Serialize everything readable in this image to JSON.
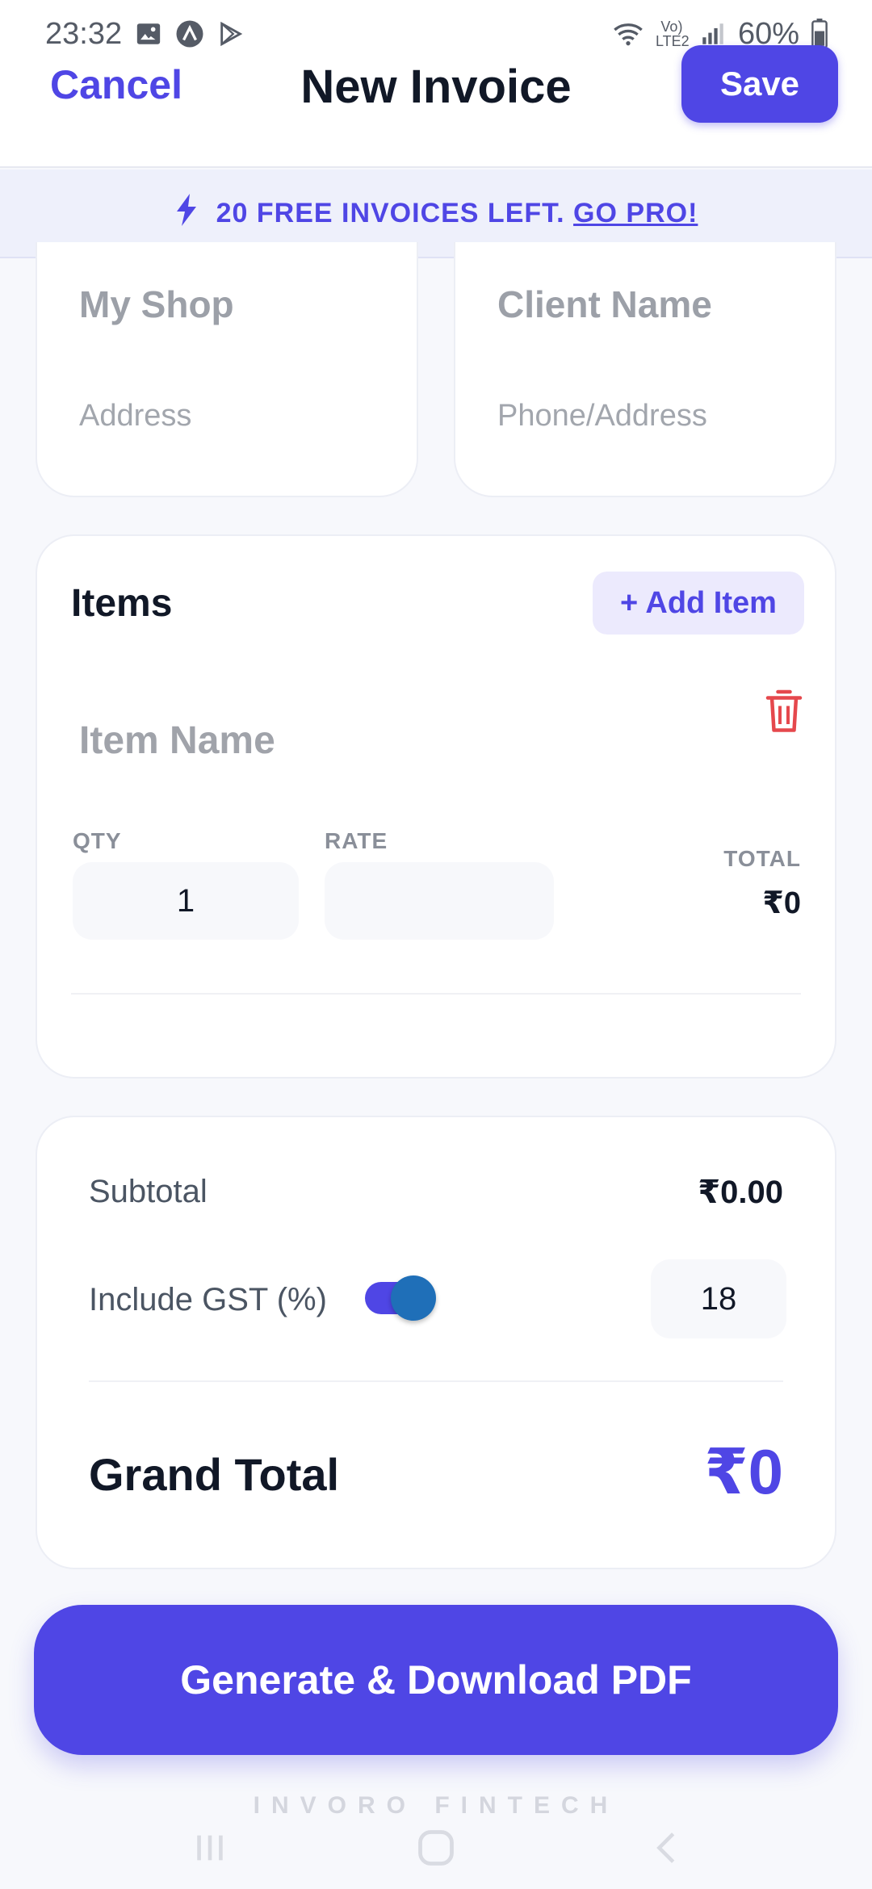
{
  "status_bar": {
    "time": "23:32",
    "battery": "60%",
    "network": "Vo) LTE2",
    "icons": [
      "gallery-icon",
      "app-icon",
      "play-store-icon",
      "wifi-icon",
      "signal-icon",
      "battery-icon"
    ]
  },
  "header": {
    "cancel_label": "Cancel",
    "title": "New Invoice",
    "save_label": "Save"
  },
  "banner": {
    "text": "20 FREE INVOICES LEFT.",
    "link": "GO PRO!",
    "icon": "lightning-icon"
  },
  "shop": {
    "name_placeholder": "My Shop",
    "address_placeholder": "Address"
  },
  "client": {
    "name_placeholder": "Client Name",
    "address_placeholder": "Phone/Address"
  },
  "items": {
    "title": "Items",
    "add_label": "+ Add Item",
    "rows": [
      {
        "name_placeholder": "Item Name",
        "qty_label": "QTY",
        "qty": "1",
        "rate_label": "RATE",
        "rate": "",
        "total_label": "TOTAL",
        "total": "₹0"
      }
    ]
  },
  "summary": {
    "subtotal_label": "Subtotal",
    "subtotal": "₹0.00",
    "gst_label": "Include GST (%)",
    "gst_enabled": true,
    "gst_rate": "18",
    "grand_total_label": "Grand Total",
    "grand_total": "₹0"
  },
  "actions": {
    "pdf_label": "Generate & Download PDF"
  },
  "footer": {
    "brand": "INVORO FINTECH"
  },
  "colors": {
    "accent": "#4f46e5",
    "delete": "#e5484d",
    "toggle_knob": "#1f6fb8"
  }
}
